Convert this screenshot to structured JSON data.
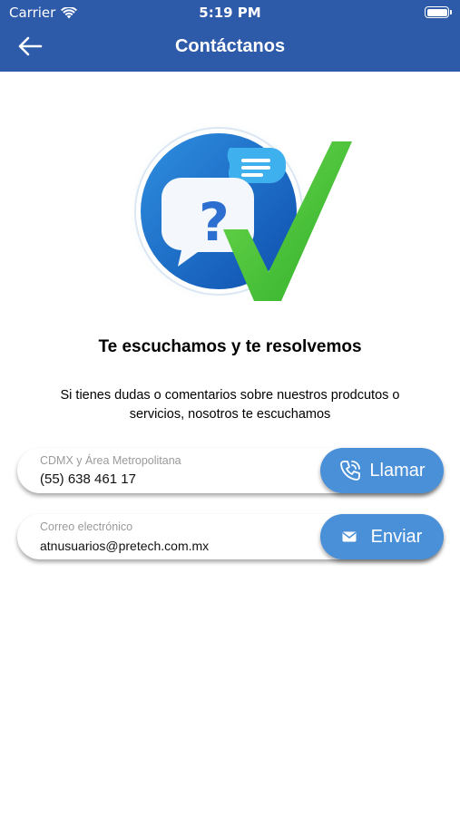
{
  "status_bar": {
    "carrier": "Carrier",
    "time": "5:19 PM",
    "battery_level": 1.0
  },
  "nav": {
    "title": "Contáctanos",
    "back_icon": "arrow-left-icon"
  },
  "hero": {
    "icons": [
      "question-bubble-icon",
      "chat-bubble-icon",
      "checkmark-icon"
    ]
  },
  "headline": "Te escuchamos y te resolvemos",
  "description": "Si tienes dudas o comentarios sobre nuestros prodcutos o servicios, nosotros te escuchamos",
  "contacts": [
    {
      "label": "CDMX y Área Metropolitana",
      "value": "(55) 638 461 17",
      "action_label": "Llamar",
      "action_icon": "phone-icon"
    },
    {
      "label": "Correo electrónico",
      "value": "atnusuarios@pretech.com.mx",
      "action_label": "Enviar",
      "action_icon": "envelope-icon"
    }
  ],
  "colors": {
    "primary": "#2d5aa9",
    "button": "#4a90d8",
    "check_green": "#4cc63a"
  }
}
